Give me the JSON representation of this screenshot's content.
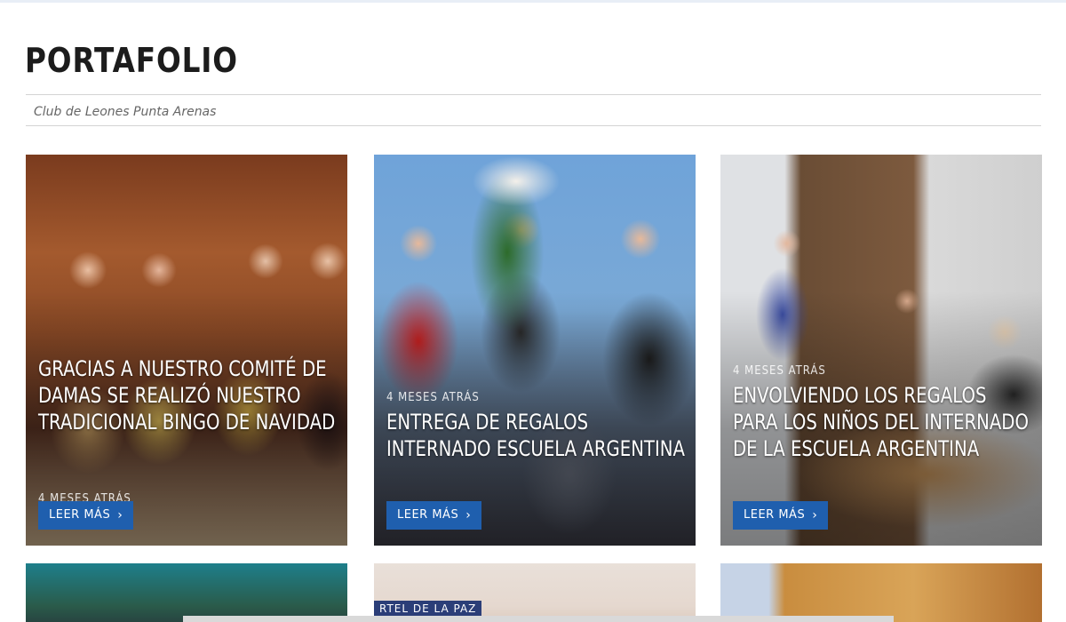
{
  "page": {
    "title": "PORTAFOLIO",
    "subtitle": "Club de Leones Punta Arenas"
  },
  "cards": [
    {
      "meta": "4 MESES ATRÁS",
      "title": "GRACIAS A NUESTRO COMITÉ DE DAMAS SE REALIZÓ NUESTRO TRADICIONAL BINGO DE NAVIDAD",
      "button": "LEER MÁS"
    },
    {
      "meta": "4 MESES ATRÁS",
      "title": "ENTREGA DE REGALOS INTERNADO ESCUELA ARGENTINA",
      "button": "LEER MÁS"
    },
    {
      "meta": "4 MESES ATRÁS",
      "title": "ENVOLVIENDO LOS REGALOS PARA LOS NIÑOS DEL INTERNADO DE LA ESCUELA ARGENTINA",
      "button": "LEER MÁS"
    }
  ],
  "lower_cards": [
    {
      "label": ""
    },
    {
      "label": "RTEL DE LA PAZ"
    },
    {
      "label": ""
    }
  ],
  "icons": {
    "button_chevron": "chevron-right-icon"
  },
  "colors": {
    "button_bg": "#1f5fae",
    "title_text": "#1c1c1c"
  }
}
